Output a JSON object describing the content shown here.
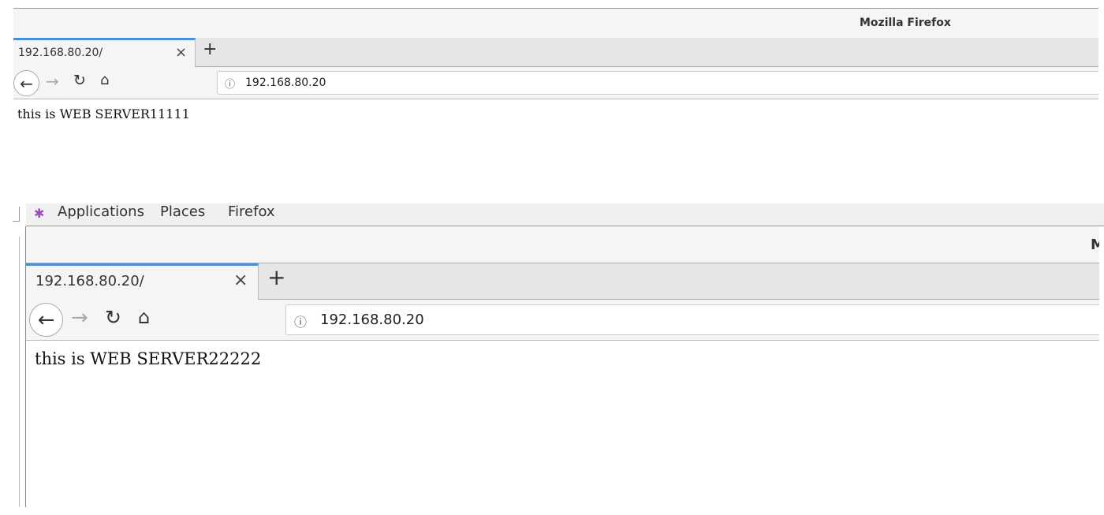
{
  "top_window": {
    "title": "Mozilla Firefox",
    "tab_title": "192.168.80.20/",
    "close_tab": "×",
    "new_tab": "+",
    "url": "192.168.80.20",
    "page_text": "this is WEB SERVER11111"
  },
  "bottom_window": {
    "menu": [
      "Applications",
      "Places",
      "Firefox"
    ],
    "title_partial": "M",
    "tab_title": "192.168.80.20/",
    "close_tab": "×",
    "new_tab": "+",
    "url": "192.168.80.20",
    "page_text": "this is WEB SERVER22222"
  },
  "colors": {
    "tab_accent": "#4a90d9",
    "chrome": "#f5f5f5",
    "tabbar": "#e6e6e6"
  },
  "icons": [
    "back-arrow-icon",
    "forward-arrow-icon",
    "reload-icon",
    "home-icon",
    "info-icon",
    "applications-icon"
  ]
}
